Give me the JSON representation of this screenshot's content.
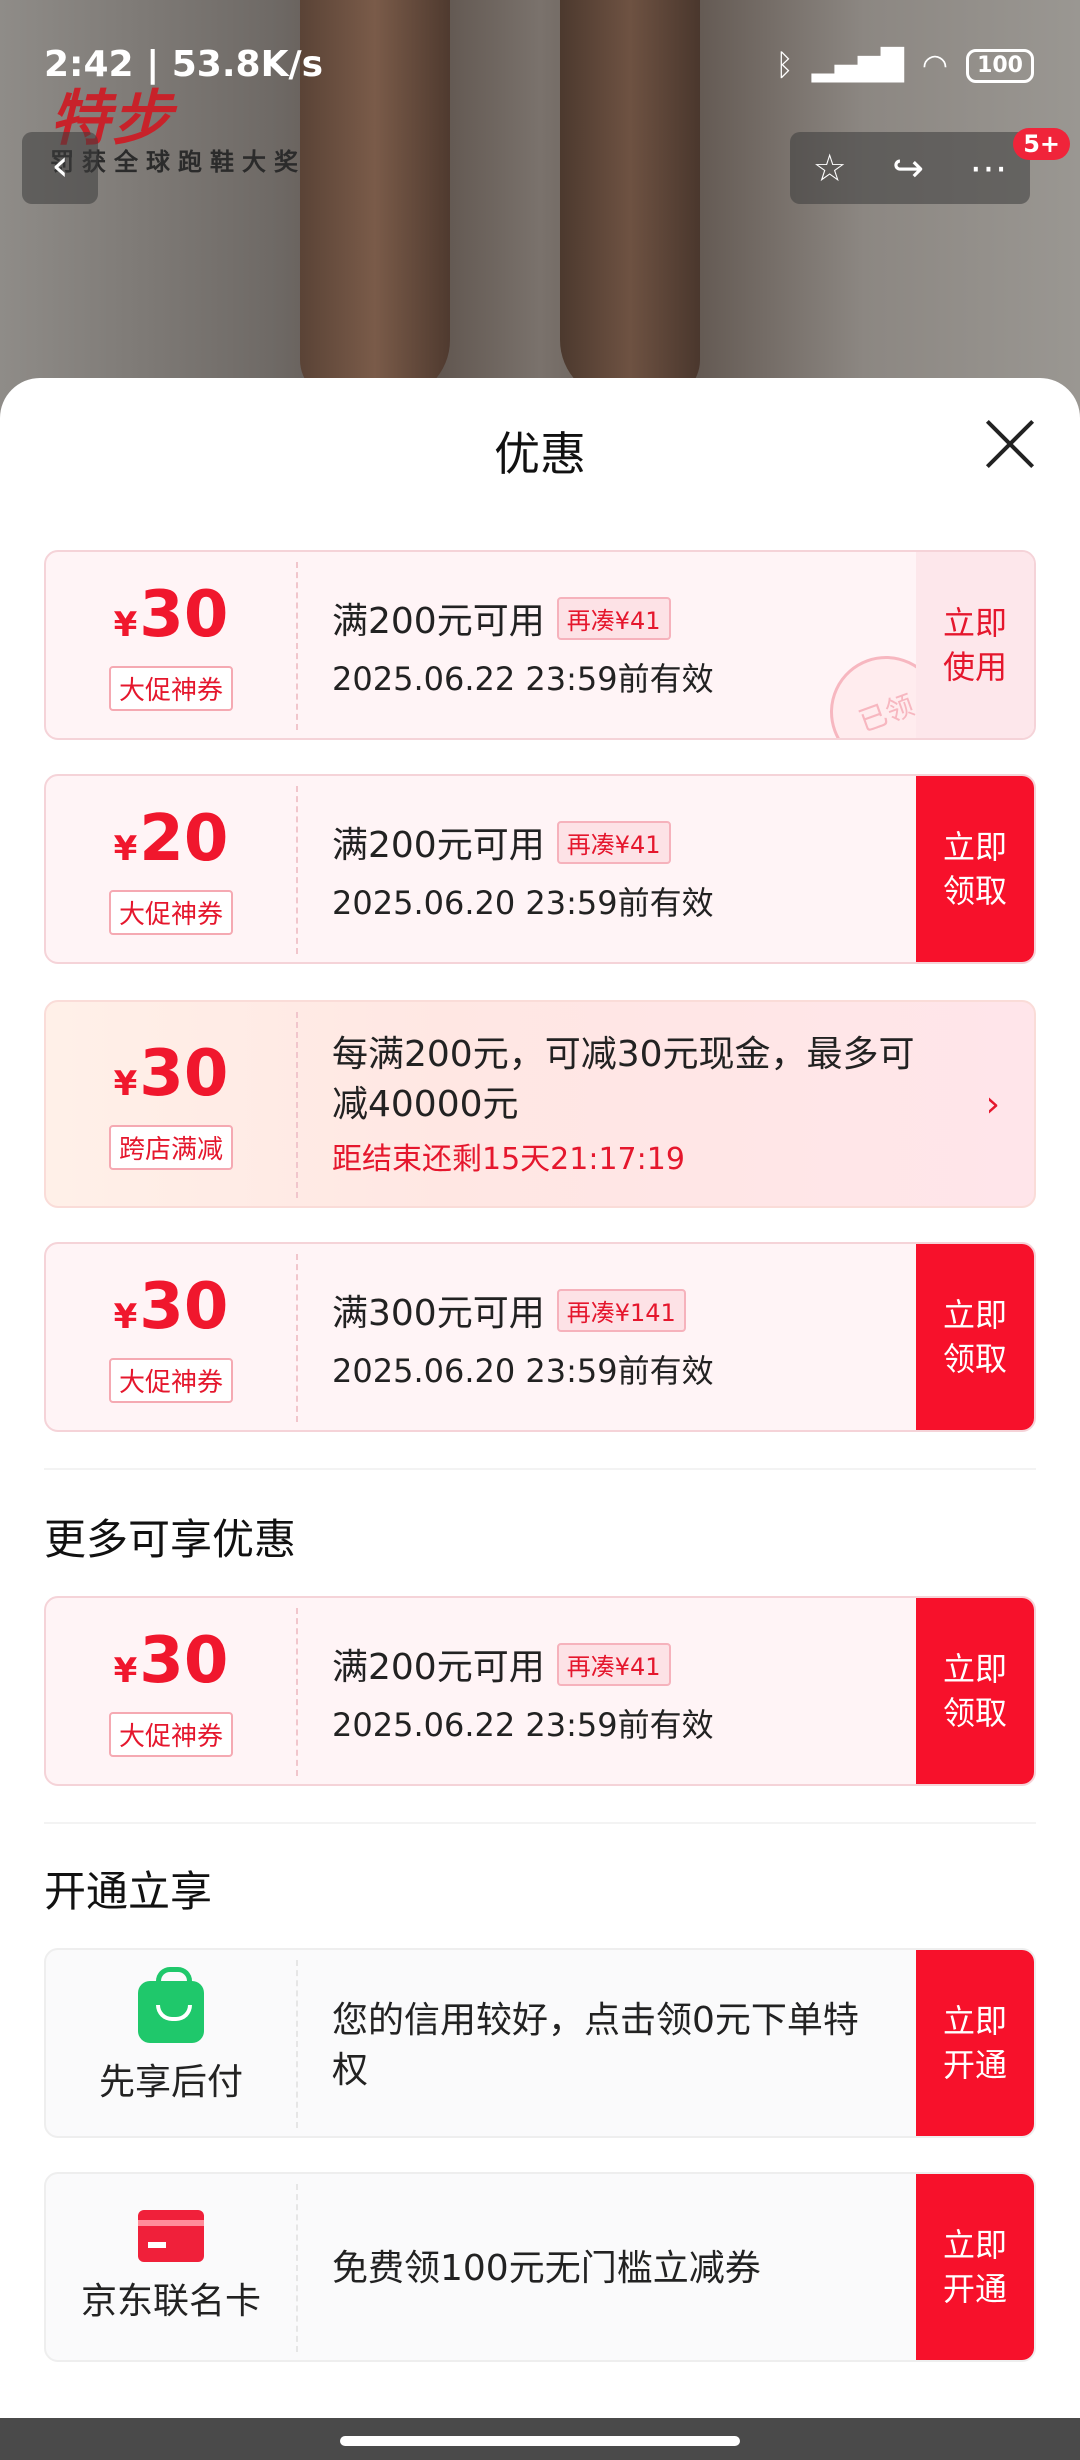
{
  "status_bar": {
    "time": "2:42 | 53.8K/s",
    "icons": [
      "bluetooth-icon",
      "signal-icon",
      "wifi-icon"
    ],
    "battery": "100"
  },
  "brand": {
    "logo": "特步",
    "slogan": "罚获全球跑鞋大奖"
  },
  "top_badge": "5+",
  "sheet": {
    "title": "优惠"
  },
  "coupons": [
    {
      "yen": "¥",
      "amount": "30",
      "tag": "大促神券",
      "condition": "满200元可用",
      "add_more": "再凑¥41",
      "expire": "2025.06.22 23:59前有效",
      "action": [
        "立即",
        "使用"
      ],
      "stamp": "已领"
    },
    {
      "yen": "¥",
      "amount": "20",
      "tag": "大促神券",
      "condition": "满200元可用",
      "add_more": "再凑¥41",
      "expire": "2025.06.20 23:59前有效",
      "action": [
        "立即",
        "领取"
      ]
    },
    {
      "yen": "¥",
      "amount": "30",
      "tag": "跨店满减",
      "desc": "每满200元，可减30元现金，最多可减40000元",
      "countdown": "距结束还剩15天21:17:19"
    },
    {
      "yen": "¥",
      "amount": "30",
      "tag": "大促神券",
      "condition": "满300元可用",
      "add_more": "再凑¥141",
      "expire": "2025.06.20 23:59前有效",
      "action": [
        "立即",
        "领取"
      ]
    }
  ],
  "more_section": {
    "title": "更多可享优惠",
    "coupon": {
      "yen": "¥",
      "amount": "30",
      "tag": "大促神券",
      "condition": "满200元可用",
      "add_more": "再凑¥41",
      "expire": "2025.06.22 23:59前有效",
      "action": [
        "立即",
        "领取"
      ]
    }
  },
  "open_section": {
    "title": "开通立享",
    "items": [
      {
        "icon": "shopping-bag-icon",
        "label": "先享后付",
        "desc": "您的信用较好，点击领0元下单特权",
        "action": [
          "立即",
          "开通"
        ]
      },
      {
        "icon": "credit-card-icon",
        "label": "京东联名卡",
        "desc": "免费领100元无门槛立减券",
        "action": [
          "立即",
          "开通"
        ]
      }
    ]
  }
}
